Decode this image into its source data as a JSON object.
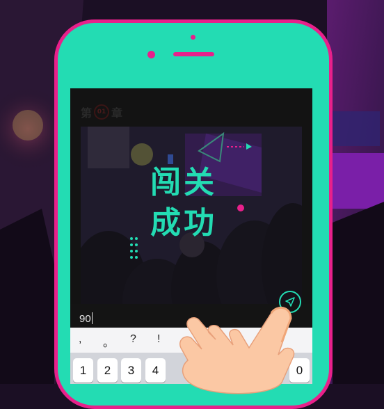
{
  "chapter": {
    "prefix": "第",
    "number": "01",
    "suffix": "章"
  },
  "result_title": {
    "line1": "闯关",
    "line2": "成功"
  },
  "answer_input": {
    "value": "90"
  },
  "keyboard": {
    "punctuation": [
      ",",
      "。",
      "?",
      "!"
    ],
    "digits": [
      "1",
      "2",
      "3",
      "4",
      "0"
    ]
  },
  "colors": {
    "accent": "#23dcb3",
    "phone_border": "#e8208b",
    "background": "#1b0f24"
  },
  "icons": {
    "send": "send-arrow-icon"
  }
}
